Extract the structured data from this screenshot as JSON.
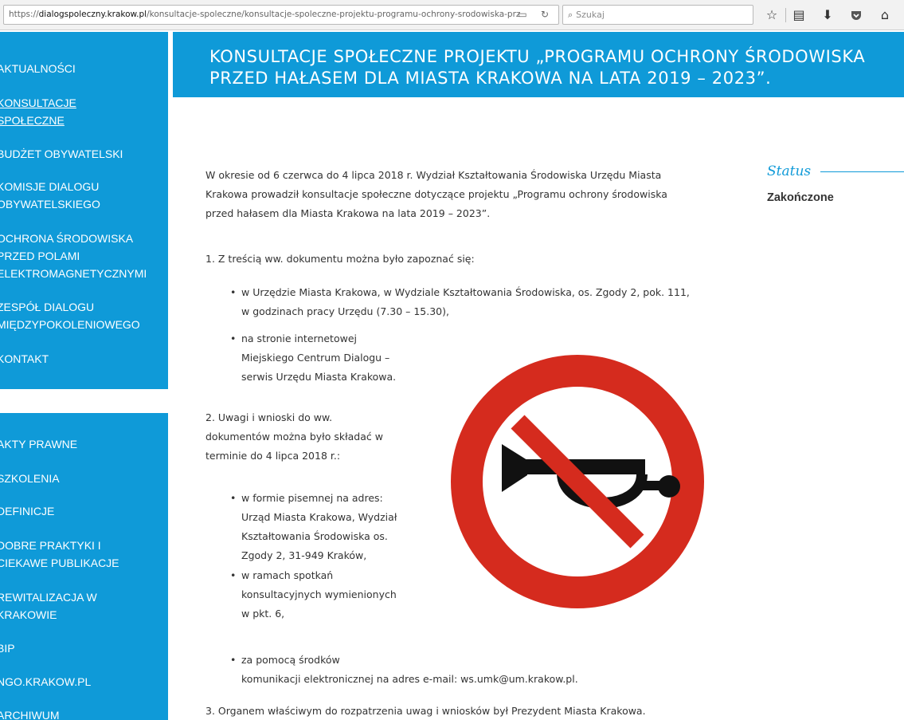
{
  "browser": {
    "url_prefix": "https://",
    "url_domain": "dialogspoleczny.krakow.pl",
    "url_path": "/konsultacje-spoleczne/konsultacje-spoleczne-projektu-programu-ochrony-srodowiska-prz",
    "search_placeholder": "Szukaj",
    "icons": [
      "reader-view-icon",
      "reload-icon",
      "search-icon",
      "bookmark-star-icon",
      "library-icon",
      "download-icon",
      "pocket-icon",
      "home-icon"
    ]
  },
  "sidebar": {
    "top_items": [
      {
        "label": "AKTUALNOŚCI"
      },
      {
        "label": "KONSULTACJE\nSPOŁECZNE"
      },
      {
        "label": "BUDŻET OBYWATELSKI"
      },
      {
        "label": "KOMISJE DIALOGU\nOBYWATELSKIEGO"
      },
      {
        "label": "OCHRONA ŚRODOWISKA\nPRZED POLAMI\nELEKTROMAGNETYCZNYMI"
      },
      {
        "label": "ZESPÓŁ DIALOGU\nMIĘDZYPOKOLENIOWEGO"
      },
      {
        "label": "KONTAKT"
      }
    ],
    "bottom_items": [
      {
        "label": "AKTY PRAWNE"
      },
      {
        "label": "SZKOLENIA"
      },
      {
        "label": "DEFINICJE"
      },
      {
        "label": "DOBRE PRAKTYKI I\nCIEKAWE PUBLIKACJE"
      },
      {
        "label": "REWITALIZACJA W\nKRAKOWIE"
      },
      {
        "label": "BIP"
      },
      {
        "label": "NGO.KRAKOW.PL"
      },
      {
        "label": "ARCHIWUM"
      }
    ]
  },
  "header": {
    "title": "KONSULTACJE SPOŁECZNE PROJEKTU „PROGRAMU OCHRONY ŚRODOWISKA PRZED HAŁASEM DLA MIASTA KRAKOWA NA LATA 2019 – 2023”."
  },
  "content": {
    "intro_lines": [
      "W okresie od 6 czerwca do 4 lipca 2018 r. Wydział Kształtowania Środowiska Urzędu Miasta",
      "Krakowa prowadził konsultacje społeczne dotyczące projektu „Programu ochrony środowiska",
      "przed hałasem dla Miasta Krakowa na lata 2019 – 2023”."
    ],
    "section1": "1. Z treścią ww. dokumentu można było zapoznać się:",
    "section1_bullets": [
      [
        "w Urzędzie Miasta Krakowa, w Wydziale Kształtowania Środowiska, os. Zgody 2, pok. 111,",
        "w godzinach pracy Urzędu (7.30 – 15.30),"
      ],
      [
        "na stronie internetowej",
        "Miejskiego Centrum Dialogu –",
        "serwis Urzędu Miasta Krakowa."
      ]
    ],
    "section2_lines": [
      "2. Uwagi i wnioski do ww.",
      "dokumentów można było składać w",
      "terminie do 4 lipca 2018 r.:"
    ],
    "section2_bullets": [
      [
        "w formie pisemnej na adres:",
        "Urząd Miasta Krakowa, Wydział",
        "Kształtowania Środowiska os.",
        "Zgody 2, 31-949 Kraków,"
      ],
      [
        "w ramach spotkań",
        "konsultacyjnych wymienionych",
        "w pkt. 6,"
      ],
      [
        "za pomocą środków",
        "komunikacji elektronicznej na adres e-mail: ws.umk@um.krakow.pl."
      ]
    ],
    "section3": "3. Organem właściwym do rozpatrzenia uwag i wniosków był Prezydent Miasta Krakowa."
  },
  "status": {
    "title": "Status",
    "value": "Zakończone"
  },
  "image": {
    "name": "no-horn-sign"
  },
  "colors": {
    "accent": "#0f9ad8",
    "sign_red": "#d52b1e",
    "text": "#333333"
  }
}
